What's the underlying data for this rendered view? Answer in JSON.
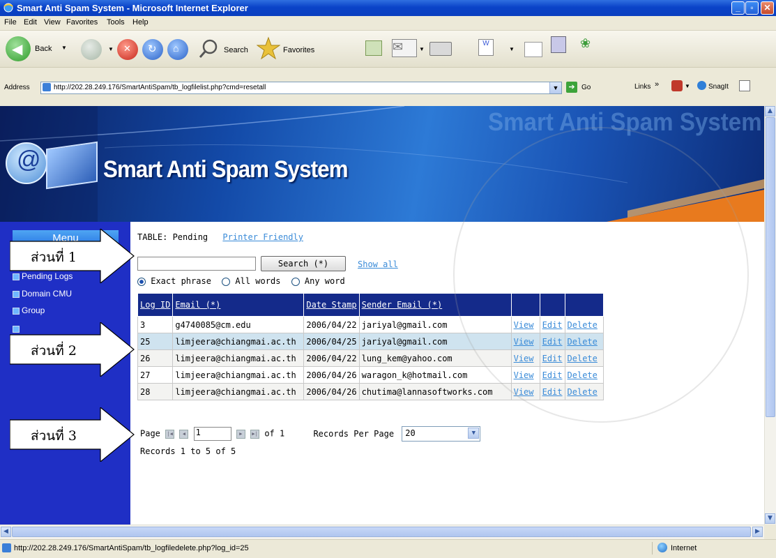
{
  "window": {
    "title": "Smart Anti Spam System - Microsoft Internet Explorer"
  },
  "menubar": [
    "File",
    "Edit",
    "View",
    "Favorites",
    "Tools",
    "Help"
  ],
  "toolbar": {
    "back": "Back",
    "search": "Search",
    "favorites": "Favorites"
  },
  "addressbar": {
    "label": "Address",
    "url": "http://202.28.249.176/SmartAntiSpam/tb_logfilelist.php?cmd=resetall",
    "go": "Go",
    "links": "Links",
    "snagit": "SnagIt"
  },
  "banner": {
    "title": "Smart Anti Spam System",
    "ghost_title": "Smart Anti Spam System",
    "logo_char": "@"
  },
  "sidebar": {
    "header": "Menu",
    "items": [
      "Pending Logs",
      "Domain CMU",
      "Group"
    ]
  },
  "page": {
    "table_label": "TABLE: Pending",
    "printer_friendly": "Printer Friendly",
    "search_value": "",
    "search_button": "Search (*)",
    "show_all": "Show all",
    "radio_options": [
      "Exact phrase",
      "All words",
      "Any word"
    ],
    "radio_selected": "Exact phrase"
  },
  "table": {
    "headers": [
      "Log ID",
      "Email (*)",
      "Date Stamp",
      "Sender Email (*)",
      "",
      "",
      ""
    ],
    "rows": [
      {
        "log_id": "3",
        "email": "g4740085@cm.edu",
        "date": "2006/04/22",
        "sender": "jariyal@gmail.com",
        "view": "View",
        "edit": "Edit",
        "delete": "Delete"
      },
      {
        "log_id": "25",
        "email": "limjeera@chiangmai.ac.th",
        "date": "2006/04/25",
        "sender": "jariyal@gmail.com",
        "view": "View",
        "edit": "Edit",
        "delete": "Delete"
      },
      {
        "log_id": "26",
        "email": "limjeera@chiangmai.ac.th",
        "date": "2006/04/22",
        "sender": "lung_kem@yahoo.com",
        "view": "View",
        "edit": "Edit",
        "delete": "Delete"
      },
      {
        "log_id": "27",
        "email": "limjeera@chiangmai.ac.th",
        "date": "2006/04/26",
        "sender": "waragon_k@hotmail.com",
        "view": "View",
        "edit": "Edit",
        "delete": "Delete"
      },
      {
        "log_id": "28",
        "email": "limjeera@chiangmai.ac.th",
        "date": "2006/04/26",
        "sender": "chutima@lannasoftworks.com",
        "view": "View",
        "edit": "Edit",
        "delete": "Delete"
      }
    ],
    "selected_row": 1
  },
  "pager": {
    "page_label": "Page",
    "page_value": "1",
    "of_label": "of 1",
    "records_per_page_label": "Records Per Page",
    "records_per_page_value": "20",
    "records_summary": "Records 1 to 5 of 5"
  },
  "annotations": {
    "part1": "ส่วนที่ 1",
    "part2": "ส่วนที่ 2",
    "part3": "ส่วนที่ 3"
  },
  "statusbar": {
    "url": "http://202.28.249.176/SmartAntiSpam/tb_logfiledelete.php?log_id=25",
    "zone": "Internet"
  },
  "colors": {
    "title_bar": "#0a43c8",
    "sidebar": "#1f2fc5",
    "table_header": "#142a8a",
    "link": "#3a8bd8",
    "selected_row": "#cfe3ef"
  },
  "icons": [
    "ie-logo-icon",
    "back-arrow-icon",
    "forward-arrow-icon",
    "stop-icon",
    "refresh-icon",
    "home-icon",
    "search-icon",
    "favorites-star-icon",
    "media-icon",
    "mail-icon",
    "print-icon",
    "edit-icon",
    "go-arrow-icon",
    "internet-globe-icon",
    "page-icon"
  ]
}
